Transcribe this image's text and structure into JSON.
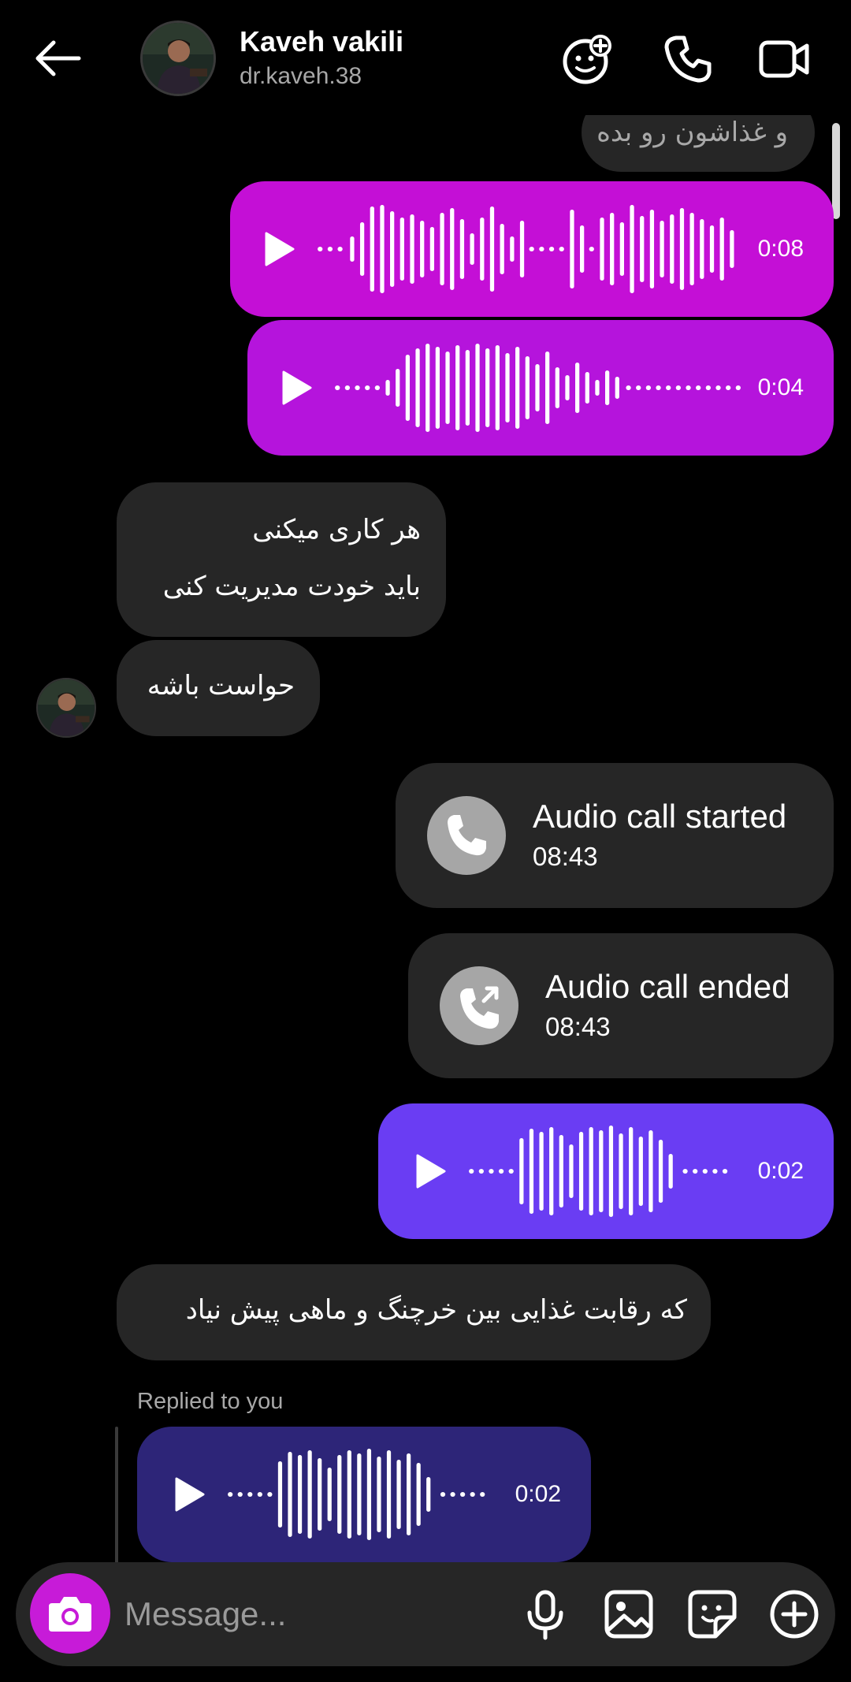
{
  "header": {
    "name": "Kaveh vakili",
    "username": "dr.kaveh.38",
    "icons": [
      "back-arrow-icon",
      "effects-face-icon",
      "phone-icon",
      "video-icon"
    ]
  },
  "messages": {
    "partial_text": "و غذاشون رو بده",
    "voice1": {
      "duration": "0:08",
      "color": "#c40fd6"
    },
    "voice2": {
      "duration": "0:04",
      "color": "#b514dc"
    },
    "text1_line1": "هر کاری میکنی",
    "text1_line2": "باید خودت مدیریت کنی",
    "text2": "حواست باشه",
    "call_started": {
      "title": "Audio call started",
      "time": "08:43"
    },
    "call_ended": {
      "title": "Audio call ended",
      "time": "08:43"
    },
    "voice3": {
      "duration": "0:02",
      "color": "#6a3df3"
    },
    "text3": "که رقابت غذایی بین خرچنگ و ماهی پیش نیاد",
    "replied_label": "Replied to you",
    "voice4": {
      "duration": "0:02",
      "color": "#2d2578"
    }
  },
  "composer": {
    "placeholder": "Message...",
    "icons": [
      "camera-icon",
      "microphone-icon",
      "gallery-icon",
      "sticker-icon",
      "plus-icon"
    ]
  },
  "colors": {
    "background": "#000000",
    "incoming_bubble": "#262626",
    "camera_button": "#c71bd8"
  }
}
